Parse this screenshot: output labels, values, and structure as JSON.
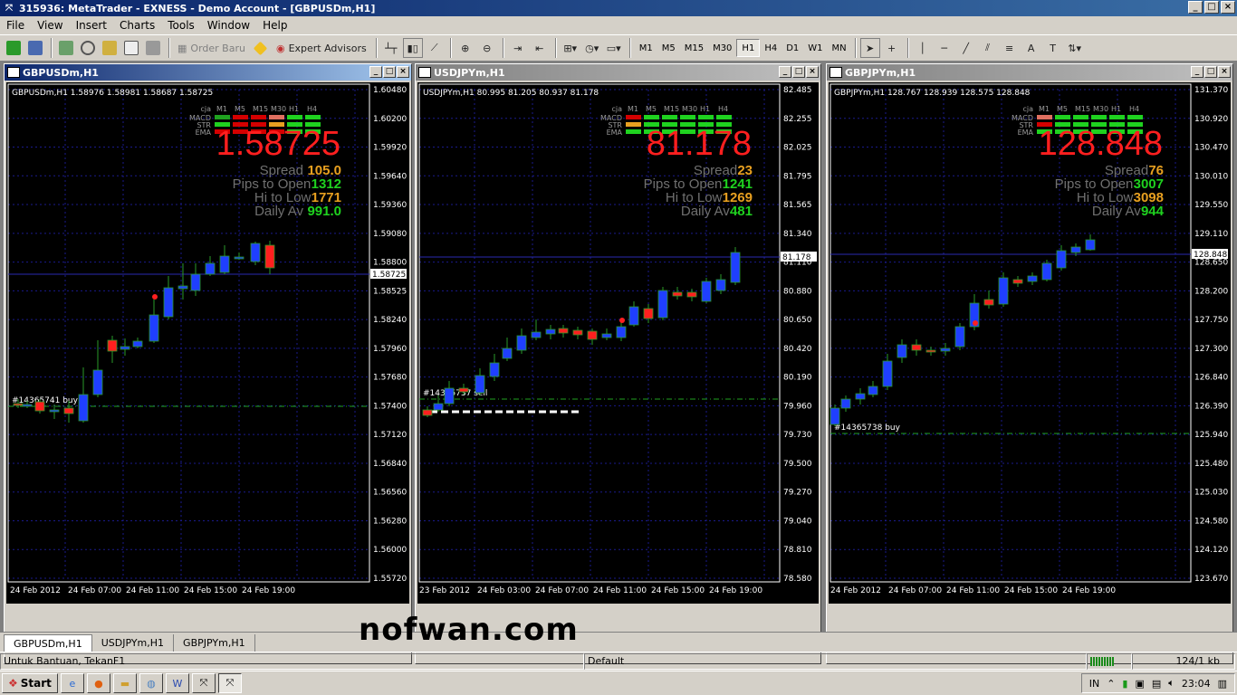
{
  "app": {
    "title": "315936: MetaTrader - EXNESS - Demo Account - [GBPUSDm,H1]"
  },
  "menu": [
    "File",
    "View",
    "Insert",
    "Charts",
    "Tools",
    "Window",
    "Help"
  ],
  "toolbar": {
    "order_label": "Order Baru",
    "ea_label": "Expert Advisors",
    "timeframes": [
      "M1",
      "M5",
      "M15",
      "M30",
      "H1",
      "H4",
      "D1",
      "W1",
      "MN"
    ],
    "active_tf": "H1"
  },
  "charts": [
    {
      "window_title": "GBPUSDm,H1",
      "info": "GBPUSDm,H1  1.58976 1.58981 1.58687 1.58725",
      "price": "1.58725",
      "spread": "105.0",
      "pips_to_open": "1312",
      "hi_to_low": "1771",
      "daily_av": "991.0",
      "price_labels": [
        "1.60480",
        "1.60200",
        "1.59920",
        "1.59640",
        "1.59360",
        "1.59080",
        "1.58800",
        "1.58525",
        "1.58240",
        "1.57960",
        "1.57680",
        "1.57400",
        "1.57120",
        "1.56840",
        "1.56560",
        "1.56280",
        "1.56000",
        "1.55720"
      ],
      "current_label": "1.58725",
      "date_labels": [
        "24 Feb 2012",
        "24 Feb 07:00",
        "24 Feb 11:00",
        "24 Feb 15:00",
        "24 Feb 19:00"
      ],
      "order_label": "#14365741 buy",
      "signals": {
        "MACD": [
          "#1fa21f",
          "#d40000",
          "#d40000",
          "#e07060",
          "#1fd21f",
          "#1fd21f"
        ],
        "STR": [
          "#1fd21f",
          "#d40000",
          "#d40000",
          "#e8a020",
          "#1fd21f",
          "#1fd21f"
        ],
        "EMA": [
          "#d40000",
          "#d40000",
          "#d40000",
          "#d40000",
          "#1fd21f",
          "#1fd21f"
        ]
      }
    },
    {
      "window_title": "USDJPYm,H1",
      "info": "USDJPYm,H1  80.995 81.205 80.937 81.178",
      "price": "81.178",
      "spread": "23",
      "pips_to_open": "1241",
      "hi_to_low": "1269",
      "daily_av": "481",
      "price_labels": [
        "82.485",
        "82.255",
        "82.025",
        "81.795",
        "81.565",
        "81.340",
        "81.110",
        "80.880",
        "80.650",
        "80.420",
        "80.190",
        "79.960",
        "79.730",
        "79.500",
        "79.270",
        "79.040",
        "78.810",
        "78.580"
      ],
      "current_label": "81.178",
      "date_labels": [
        "23 Feb 2012",
        "24 Feb 03:00",
        "24 Feb 07:00",
        "24 Feb 11:00",
        "24 Feb 15:00",
        "24 Feb 19:00"
      ],
      "order_label": "#14365737 sell",
      "signals": {
        "MACD": [
          "#d40000",
          "#1fd21f",
          "#1fd21f",
          "#1fd21f",
          "#1fd21f",
          "#1fd21f"
        ],
        "STR": [
          "#e8a020",
          "#1fd21f",
          "#1fd21f",
          "#1fd21f",
          "#1fd21f",
          "#1fd21f"
        ],
        "EMA": [
          "#1fd21f",
          "#1fd21f",
          "#1fd21f",
          "#1fd21f",
          "#1fd21f",
          "#1fd21f"
        ]
      }
    },
    {
      "window_title": "GBPJPYm,H1",
      "info": "GBPJPYm,H1  128.767 128.939 128.575 128.848",
      "price": "128.848",
      "spread": "76",
      "pips_to_open": "3007",
      "hi_to_low": "3098",
      "daily_av": "944",
      "price_labels": [
        "131.370",
        "130.920",
        "130.470",
        "130.010",
        "129.550",
        "129.110",
        "128.650",
        "128.200",
        "127.750",
        "127.300",
        "126.840",
        "126.390",
        "125.940",
        "125.480",
        "125.030",
        "124.580",
        "124.120",
        "123.670"
      ],
      "current_label": "128.848",
      "date_labels": [
        "24 Feb 2012",
        "24 Feb 07:00",
        "24 Feb 11:00",
        "24 Feb 15:00",
        "24 Feb 19:00"
      ],
      "order_label": "#14365738 buy",
      "signals": {
        "MACD": [
          "#e07060",
          "#1fd21f",
          "#1fd21f",
          "#1fd21f",
          "#1fd21f",
          "#1fd21f"
        ],
        "STR": [
          "#d40000",
          "#1fd21f",
          "#1fd21f",
          "#1fd21f",
          "#1fd21f",
          "#1fd21f"
        ],
        "EMA": [
          "#1fd21f",
          "#1fd21f",
          "#1fd21f",
          "#1fd21f",
          "#1fd21f",
          "#1fd21f"
        ]
      }
    }
  ],
  "signal_header": {
    "label": "cja",
    "tfs": [
      "M1",
      "M5",
      "M15",
      "M30",
      "H1",
      "H4"
    ],
    "rows": [
      "MACD",
      "STR",
      "EMA"
    ]
  },
  "stat_labels": {
    "spread": "Spread",
    "pips": "Pips to Open",
    "hilo": "Hi to Low",
    "daily": "Daily Av"
  },
  "tabs": [
    "GBPUSDm,H1",
    "USDJPYm,H1",
    "GBPJPYm,H1"
  ],
  "watermark": "nofwan.com",
  "status": {
    "help": "Untuk Bantuan, TekanF1",
    "profile": "Default",
    "traffic": "124/1 kb"
  },
  "taskbar": {
    "start": "Start",
    "lang": "IN",
    "clock": "23:04"
  },
  "colors": {
    "bull": "#1f3fff",
    "bear": "#ff1f1f",
    "price_big": "#ff1f1f",
    "grid": "#1a1a8c",
    "spread_val": "#e8a020",
    "pips_val": "#1fd21f",
    "hilo_val": "#e8a020",
    "daily_val": "#1fd21f"
  }
}
